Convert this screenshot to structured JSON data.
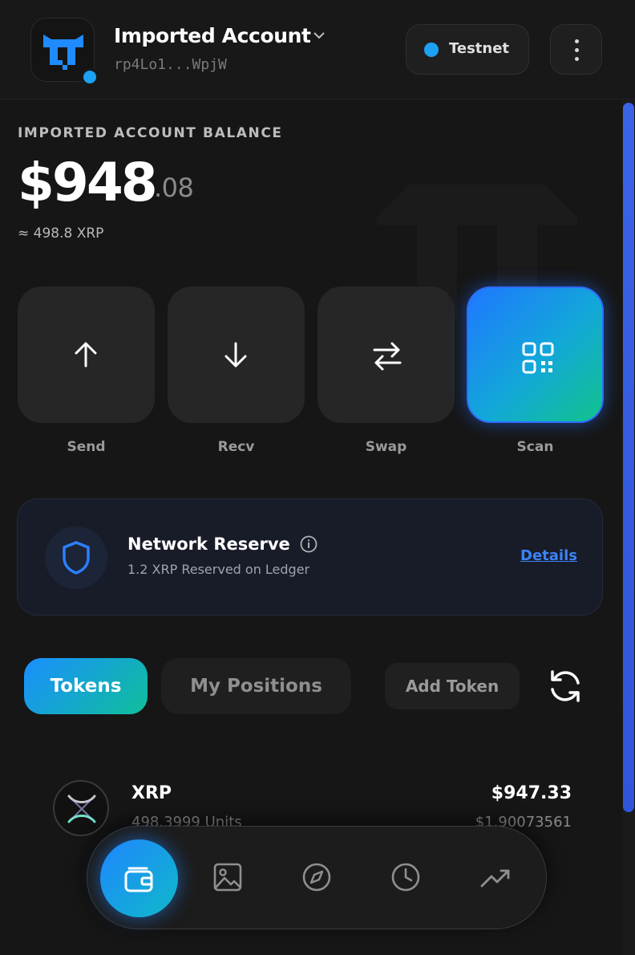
{
  "header": {
    "account_name": "Imported Account",
    "account_address": "rp4Lo1...WpjW",
    "network_label": "Testnet"
  },
  "balance": {
    "label": "IMPORTED ACCOUNT BALANCE",
    "main": "$948",
    "cents": ".08",
    "xrp_equivalent": "≈ 498.8 XRP"
  },
  "actions": [
    {
      "label": "Send",
      "icon": "arrow-up-icon"
    },
    {
      "label": "Recv",
      "icon": "arrow-down-icon"
    },
    {
      "label": "Swap",
      "icon": "swap-icon"
    },
    {
      "label": "Scan",
      "icon": "qr-code-icon"
    }
  ],
  "reserve": {
    "title": "Network Reserve",
    "subtitle": "1.2 XRP Reserved on Ledger",
    "link": "Details"
  },
  "tabs": {
    "tokens": "Tokens",
    "positions": "My Positions",
    "add_token": "Add Token"
  },
  "tokens": [
    {
      "name": "XRP",
      "units": "498.3999 Units",
      "usd_value": "$947.33",
      "price": "$1.90073561"
    }
  ],
  "nav": [
    "wallet-icon",
    "gallery-icon",
    "compass-icon",
    "clock-icon",
    "trending-up-icon"
  ],
  "colors": {
    "accent_blue": "#1da1f2",
    "link_blue": "#3b82f6",
    "gradient_green": "#11c38a",
    "background": "#161616"
  }
}
